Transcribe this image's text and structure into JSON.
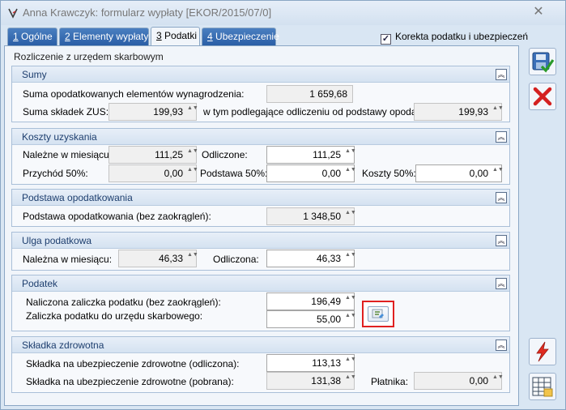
{
  "window": {
    "title": "Anna Krawczyk: formularz wypłaty [EKOR/2015/07/0]",
    "close_glyph": "✕"
  },
  "tabs": [
    {
      "key": "1",
      "label": " Ogólne"
    },
    {
      "key": "2",
      "label": " Elementy wypłaty"
    },
    {
      "key": "3",
      "label": " Podatki"
    },
    {
      "key": "4",
      "label": " Ubezpieczenie"
    }
  ],
  "active_tab": "Podatki",
  "korekta": {
    "label": "Korekta podatku i ubezpieczeń",
    "checked": true
  },
  "panel_title": "Rozliczenie z urzędem skarbowym",
  "sumy": {
    "title": "Sumy",
    "suma_opodatkowanych_label": "Suma opodatkowanych elementów wynagrodzenia:",
    "suma_opodatkowanych_value": "1 659,68",
    "suma_zus_label": "Suma składek ZUS:",
    "suma_zus_value": "199,93",
    "podlegajace_label": "w tym podlegające odliczeniu od podstawy opodat.:",
    "podlegajace_value": "199,93"
  },
  "koszty": {
    "title": "Koszty uzyskania",
    "nalezne_label": "Należne w miesiącu:",
    "nalezne_value": "111,25",
    "odliczone_label": "Odliczone:",
    "odliczone_value": "111,25",
    "przychod_label": "Przychód 50%:",
    "przychod_value": "0,00",
    "podstawa50_label": "Podstawa 50%:",
    "podstawa50_value": "0,00",
    "koszty50_label": "Koszty 50%:",
    "koszty50_value": "0,00"
  },
  "podstawa": {
    "title": "Podstawa opodatkowania",
    "label": "Podstawa opodatkowania (bez zaokrągleń):",
    "value": "1 348,50"
  },
  "ulga": {
    "title": "Ulga podatkowa",
    "nalezna_label": "Należna w miesiącu:",
    "nalezna_value": "46,33",
    "odliczona_label": "Odliczona:",
    "odliczona_value": "46,33"
  },
  "podatek": {
    "title": "Podatek",
    "naliczona_label": "Naliczona zaliczka podatku (bez zaokrągleń):",
    "naliczona_value": "196,49",
    "zaliczka_label": "Zaliczka podatku do urzędu skarbowego:",
    "zaliczka_value": "55,00"
  },
  "zdrowotna": {
    "title": "Składka zdrowotna",
    "odliczona_label": "Składka na ubezpieczenie zdrowotne (odliczona):",
    "odliczona_value": "113,13",
    "pobrana_label": "Składka na ubezpieczenie zdrowotne (pobrana):",
    "pobrana_value": "131,38",
    "platnika_label": "Płatnika:",
    "platnika_value": "0,00"
  },
  "icons": {
    "save": "save-check-icon",
    "cancel": "red-x-icon",
    "lightning": "lightning-icon",
    "table": "table-icon",
    "calc": "recalculate-icon",
    "collapse_glyph": "︽",
    "spin_glyph": "▲▼"
  },
  "colors": {
    "accent": "#2a5ea6",
    "highlight": "#e02020",
    "panel": "#f1f5fa"
  }
}
